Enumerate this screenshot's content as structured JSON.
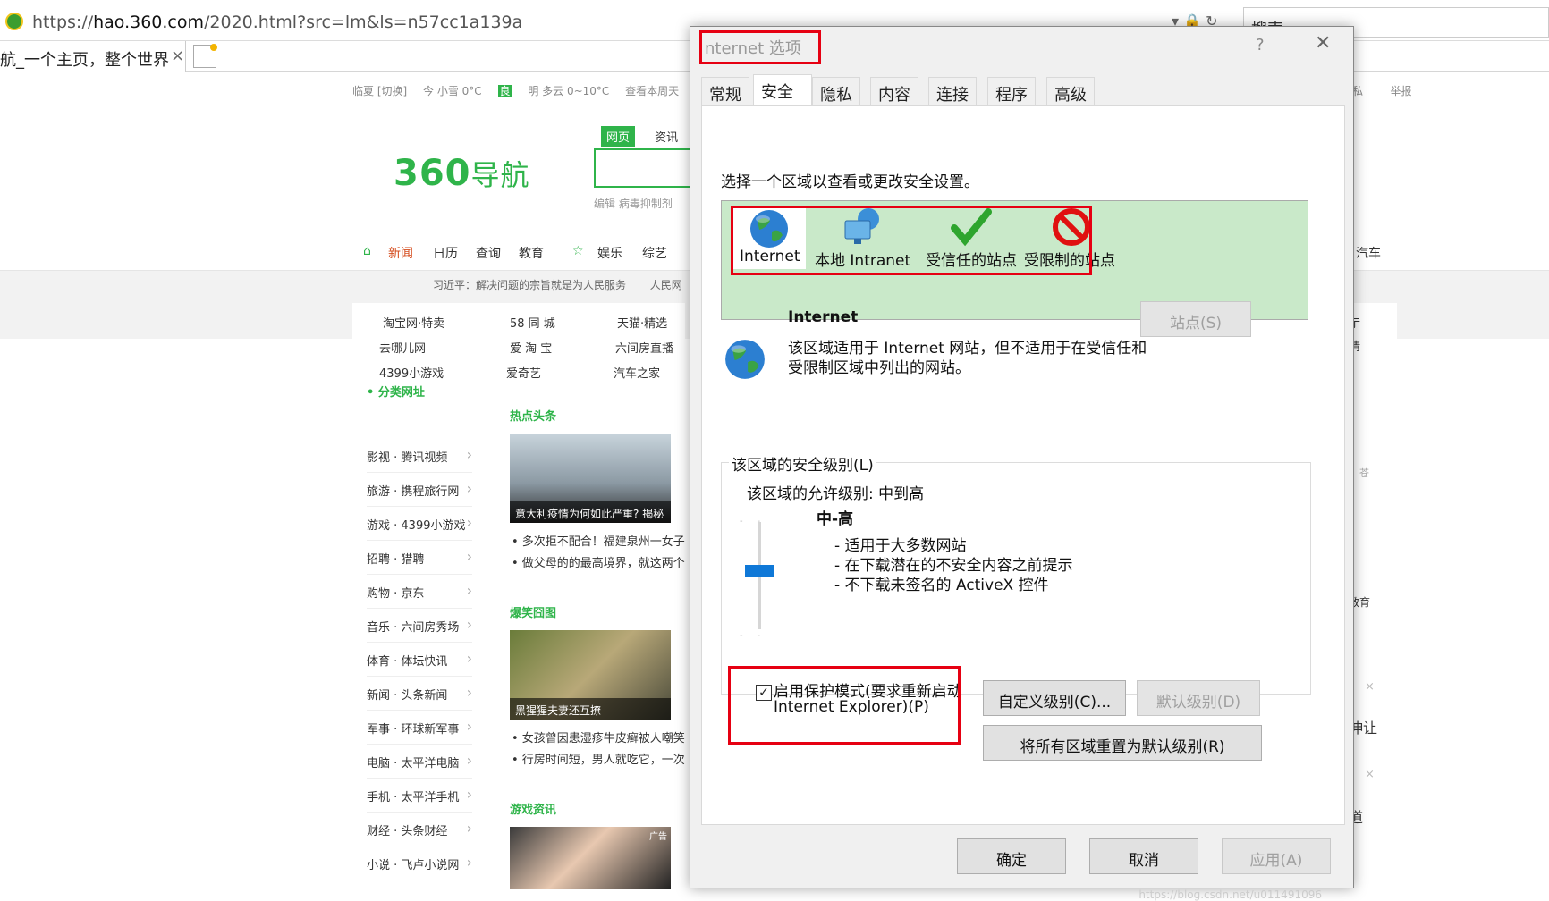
{
  "browser": {
    "url_pre": "https://",
    "url_host": "hao.360.com",
    "url_rest": "/2020.html?src=lm&ls=n57cc1a139a",
    "search_label": "搜索",
    "tab_title": "航_一个主页，整个世界",
    "tab_close": "×"
  },
  "page": {
    "weather": [
      "临夏 [切换]",
      "今 小雪 0°C",
      "良",
      "明 多云 0~10°C",
      "查看本周天"
    ],
    "topright": [
      "私",
      "举报"
    ],
    "logo_num": "360",
    "logo_text": "导航",
    "search_tabs": [
      "网页",
      "资讯"
    ],
    "search_hint": "编辑 病毒抑制剂",
    "nav": [
      "新闻",
      "日历",
      "查询",
      "教育",
      "娱乐",
      "综艺",
      " ",
      "汽车"
    ],
    "ticker": [
      "习近平：解决问题的宗旨就是为人民服务",
      "人民网"
    ],
    "sites": [
      [
        "淘宝网·特卖",
        "58 同 城",
        "天猫·精选"
      ],
      [
        "去哪儿网",
        "爱 淘 宝",
        "六间房直播"
      ],
      [
        "4399小游戏",
        "爱奇艺",
        "汽车之家"
      ]
    ],
    "category_title": "• 分类网址",
    "categories": [
      "影视 · 腾讯视频",
      "旅游 · 携程旅行网",
      "游戏 · 4399小游戏",
      "招聘 · 猎聘",
      "购物 · 京东",
      "音乐 · 六间房秀场",
      "体育 · 体坛快讯",
      "新闻 · 头条新闻",
      "军事 · 环球新军事",
      "电脑 · 太平洋电脑",
      "手机 · 太平洋手机",
      "财经 · 头条财经",
      "小说 · 飞卢小说网"
    ],
    "sections": [
      {
        "title": "热点头条",
        "caption": "意大利疫情为何如此严重? 揭秘",
        "items": [
          "• 多次拒不配合！福建泉州一女子",
          "• 做父母的的最高境界，就这两个"
        ]
      },
      {
        "title": "爆笑囧图",
        "caption": "黑猩猩夫妻还互撩",
        "items": [
          "• 女孩曾因患湿疹牛皮癣被人嘲笑",
          "• 行房时间短，男人就吃它，一次"
        ]
      },
      {
        "title": "游戏资讯",
        "caption": "广告",
        "items": []
      }
    ],
    "right_col": [
      "亍",
      "情",
      "教育",
      "伸让",
      "道",
      "苍",
      "×",
      "×"
    ]
  },
  "dialog": {
    "title": "nternet 选项",
    "help": "?",
    "close": "✕",
    "tabs": [
      "常规",
      "安全",
      "隐私",
      "内容",
      "连接",
      "程序",
      "高级"
    ],
    "zone_prompt": "选择一个区域以查看或更改安全设置。",
    "zones": [
      "Internet",
      "本地 Intranet",
      "受信任的站点",
      "受限制的站点"
    ],
    "zone_name": "Internet",
    "sites_button": "站点(S)",
    "zone_desc_1": "该区域适用于 Internet 网站，但不适用于在受信任和",
    "zone_desc_2": "受限制区域中列出的网站。",
    "group_label": "该区域的安全级别(L)",
    "allowed_level": "该区域的允许级别: 中到高",
    "level_name": "中-高",
    "level_points": [
      "- 适用于大多数网站",
      "- 在下载潜在的不安全内容之前提示",
      "- 不下载未签名的 ActiveX 控件"
    ],
    "protected_mode_1": "启用保护模式(要求重新启动",
    "protected_mode_2": "Internet Explorer)(P)",
    "protected_mode_checked": true,
    "custom_level_button": "自定义级别(C)...",
    "default_level_button": "默认级别(D)",
    "reset_all_button": "将所有区域重置为默认级别(R)",
    "ok_button": "确定",
    "cancel_button": "取消",
    "apply_button": "应用(A)",
    "watermark": "https://blog.csdn.net/u011491096"
  },
  "colors": {
    "highlight_red": "#e60012",
    "zone_green": "#c9e9c9",
    "slider_blue": "#0f78d7",
    "brand_green": "#2fb44a"
  }
}
